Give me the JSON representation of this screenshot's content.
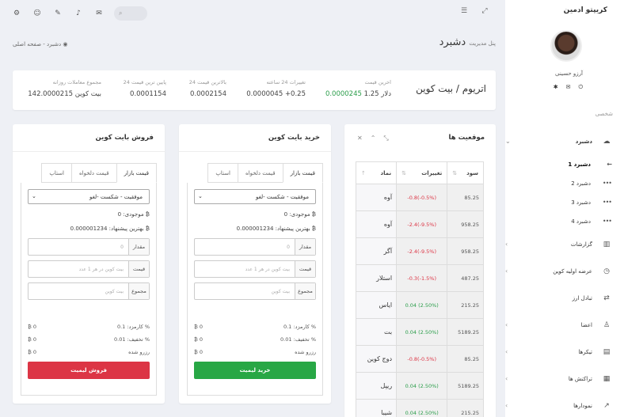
{
  "app": {
    "brand": "کریپتو ادمین"
  },
  "user": {
    "name": "آرزو حسینی"
  },
  "sidebar": {
    "section": "شخصی",
    "items": [
      {
        "label": "دشبرد",
        "icon": "dashboard-icon",
        "active": true
      },
      {
        "label": "گزارشات",
        "icon": "chart-icon"
      },
      {
        "label": "عرضه اولیه کوین",
        "icon": "clock-icon"
      },
      {
        "label": "تبادل ارز",
        "icon": "exchange-icon"
      },
      {
        "label": "اعضا",
        "icon": "user-icon"
      },
      {
        "label": "تیکرها",
        "icon": "ticker-icon"
      },
      {
        "label": "تراکنش ها",
        "icon": "transactions-icon"
      },
      {
        "label": "نمودارها",
        "icon": "graph-icon"
      }
    ],
    "subitems": [
      "دشبرد 1",
      "دشبرد 2",
      "دشبرد 3",
      "دشبرد 4"
    ]
  },
  "page": {
    "title": "دشبرد",
    "subtitle": "پنل مدیریت",
    "breadcrumb_home": "صفحه اصلی",
    "breadcrumb_sep": "-",
    "breadcrumb_current": "دشبرد"
  },
  "search": {
    "placeholder": ""
  },
  "ticker": {
    "pair": "اتریوم / بیت کوین",
    "stats": [
      {
        "label": "اخرین قیمت",
        "value": "0.0000245",
        "extra": "1.25 دلار"
      },
      {
        "label": "تغییرات 24 ساعته",
        "value": "0.0000045",
        "extra": "+0.25"
      },
      {
        "label": "بالاترین قیمت 24",
        "value": "0.0002154"
      },
      {
        "label": "پایین ترین قیمت 24",
        "value": "0.0001154"
      },
      {
        "label": "مجموع معاملات روزانه",
        "value": "142.0000215 بیت کوین"
      }
    ]
  },
  "buy": {
    "title": "خرید بایت کوین",
    "tabs": [
      "قیمت بازار",
      "قیمت دلخواه",
      "استاپ"
    ],
    "select": "موفقیت - شکست -لغو",
    "balance": "موجودی: 0 ₿",
    "best": "بهترین پیشنهاد: 0.000001234 ₿",
    "amount_label": "مقدار",
    "amount_ph": "0",
    "price_label": "قیمت",
    "price_ph": "بیت کوین در هر 1 عدد",
    "total_label": "مجموع",
    "total_ph": "بیت کوین",
    "fee_label": "کارمزد: 0.1 %",
    "fee_val": "₿ 0",
    "disc_label": "تخفیف: 0.01 %",
    "disc_val": "₿ 0",
    "reserve_label": "رزرو شده",
    "reserve_val": "₿ 0",
    "button": "خرید لیمیت"
  },
  "sell": {
    "title": "فروش بایت کوین",
    "tabs": [
      "قیمت بازار",
      "قیمت دلخواه",
      "استاپ"
    ],
    "select": "موفقیت - شکست -لغو",
    "balance": "موجودی: 0 ₿",
    "best": "بهترین پیشنهاد: 0.000001234 ₿",
    "amount_label": "مقدار",
    "amount_ph": "0",
    "price_label": "قیمت",
    "price_ph": "بیت کوین در هر 1 عدد",
    "total_label": "مجموع",
    "total_ph": "بیت کوین",
    "fee_label": "کارمزد: 0.1 %",
    "fee_val": "₿ 0",
    "disc_label": "تخفیف: 0.01 %",
    "disc_val": "₿ 0",
    "reserve_label": "رزرو شده",
    "reserve_val": "₿ 0",
    "button": "فروش لیمیت"
  },
  "positions": {
    "title": "موقعیت ها",
    "headers": [
      "نماد",
      "تغییرات",
      "سود"
    ],
    "rows": [
      {
        "sym": "آوه",
        "chg": "-0.8(-0.5%)",
        "up": false,
        "profit": "85.25"
      },
      {
        "sym": "آوه",
        "chg": "-2.4(-9.5%)",
        "up": false,
        "profit": "958.25"
      },
      {
        "sym": "آگر",
        "chg": "-2.4(-9.5%)",
        "up": false,
        "profit": "958.25"
      },
      {
        "sym": "استلار",
        "chg": "-0.3(-1.5%)",
        "up": false,
        "profit": "487.25"
      },
      {
        "sym": "ایاس",
        "chg": "0.04 (2.50%)",
        "up": true,
        "profit": "215.25"
      },
      {
        "sym": "بت",
        "chg": "0.04 (2.50%)",
        "up": true,
        "profit": "5189.25"
      },
      {
        "sym": "دوج کوین",
        "chg": "-0.8(-0.5%)",
        "up": false,
        "profit": "85.25"
      },
      {
        "sym": "ریپل",
        "chg": "0.04 (2.50%)",
        "up": true,
        "profit": "5189.25"
      },
      {
        "sym": "شیبا",
        "chg": "0.04 (2.50%)",
        "up": true,
        "profit": "215.25"
      }
    ]
  },
  "colors": {
    "green": "#2a9d4a",
    "red": "#dc3545",
    "bg": "#eef0f5"
  }
}
